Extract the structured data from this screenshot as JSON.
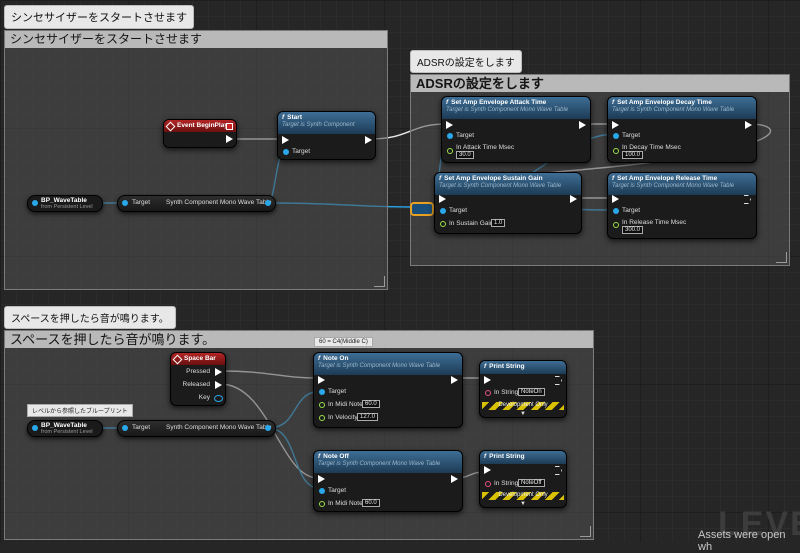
{
  "tooltips": {
    "top": "シンセサイザーをスタートさせます",
    "adsr": "ADSRの設定をします",
    "bottom": "スペースを押したら音が鳴ります。"
  },
  "comments": {
    "start_title": "シンセサイザーをスタートさせます",
    "adsr_title": "ADSRの設定をします",
    "play_title": "スペースを押したら音が鳴ります。"
  },
  "event_beginplay": {
    "title": "Event BeginPlay"
  },
  "start_node": {
    "title": "Start",
    "subtitle": "Target is Synth Component",
    "target": "Target"
  },
  "bp_wavetable_1": {
    "title": "BP_WaveTable",
    "subtitle": "from Persistent Level"
  },
  "cast_1": {
    "target": "Target",
    "output": "Synth Component Mono Wave Table"
  },
  "attack": {
    "title": "Set Amp Envelope Attack Time",
    "subtitle": "Target is Synth Component Mono Wave Table",
    "target": "Target",
    "param": "In Attack Time Msec",
    "value": "30.0"
  },
  "decay": {
    "title": "Set Amp Envelope Decay Time",
    "subtitle": "Target is Synth Component Mono Wave Table",
    "target": "Target",
    "param": "In Decay Time Msec",
    "value": "100.0"
  },
  "sustain": {
    "title": "Set Amp Envelope Sustain Gain",
    "subtitle": "Target is Synth Component Mono Wave Table",
    "target": "Target",
    "param": "In Sustain Gain",
    "value": "1.0"
  },
  "release": {
    "title": "Set Amp Envelope Release Time",
    "subtitle": "Target is Synth Component Mono Wave Table",
    "target": "Target",
    "param": "In Release Time Msec",
    "value": "300.0"
  },
  "space_bar": {
    "title": "Space Bar",
    "pressed": "Pressed",
    "released": "Released",
    "key": "Key"
  },
  "note_hint": "60 = C4(Middle C)",
  "level_ref_hint": "レベルから参照したブループリント",
  "bp_wavetable_2": {
    "title": "BP_WaveTable",
    "subtitle": "from Persistent Level"
  },
  "cast_2": {
    "target": "Target",
    "output": "Synth Component Mono Wave Table"
  },
  "note_on": {
    "title": "Note On",
    "subtitle": "Target is Synth Component Mono Wave Table",
    "target": "Target",
    "midi_note": "In Midi Note",
    "midi_note_value": "60.0",
    "velocity": "In Velocity",
    "velocity_value": "127.0"
  },
  "note_off": {
    "title": "Note Off",
    "subtitle": "Target is Synth Component Mono Wave Table",
    "target": "Target",
    "midi_note": "In Midi Note",
    "midi_note_value": "60.0"
  },
  "print_1": {
    "title": "Print String",
    "in_string": "In String",
    "value": "NoteOn",
    "dev": "Development Only"
  },
  "print_2": {
    "title": "Print String",
    "in_string": "In String",
    "value": "NoteOff",
    "dev": "Development Only"
  },
  "watermark": "LEVE",
  "toast": "Assets were open wh",
  "colors": {
    "exec": "#ffffff",
    "object": "#2aa7e8",
    "float": "#9be24a",
    "string": "#ea4f88",
    "event_header": "#b32525",
    "function_header": "#3e6e95"
  }
}
